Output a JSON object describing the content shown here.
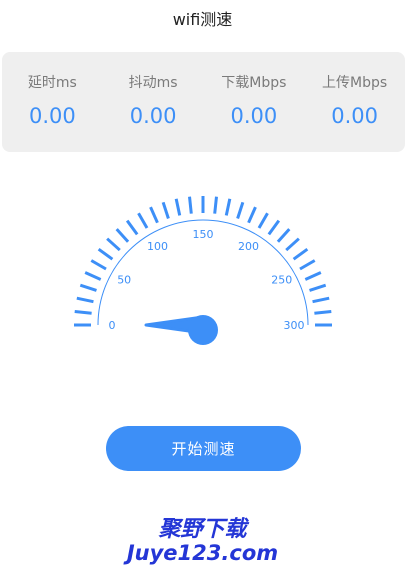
{
  "header": {
    "title": "wifi测速"
  },
  "stats": [
    {
      "label": "延时ms",
      "value": "0.00"
    },
    {
      "label": "抖动ms",
      "value": "0.00"
    },
    {
      "label": "下载Mbps",
      "value": "0.00"
    },
    {
      "label": "上传Mbps",
      "value": "0.00"
    }
  ],
  "gauge": {
    "min": 0,
    "max": 300,
    "current": 0,
    "tick_labels": [
      "0",
      "50",
      "100",
      "150",
      "200",
      "250",
      "300"
    ],
    "accent_color": "#3d8ff7"
  },
  "actions": {
    "start_label": "开始测速"
  },
  "watermark": {
    "line1": "聚野下载",
    "line2": "Juye123.com",
    "color": "#2436d6"
  }
}
